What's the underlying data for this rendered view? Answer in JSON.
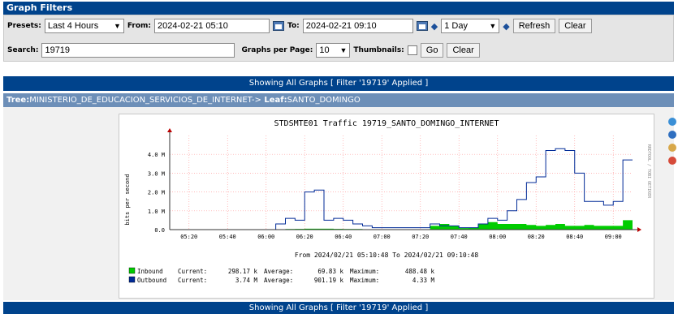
{
  "filters": {
    "title": "Graph Filters",
    "presets_label": "Presets:",
    "presets_value": "Last 4 Hours",
    "from_label": "From:",
    "from_value": "2024-02-21 05:10",
    "to_label": "To:",
    "to_value": "2024-02-21 09:10",
    "span_value": "1 Day",
    "refresh_label": "Refresh",
    "clear_label": "Clear",
    "search_label": "Search:",
    "search_value": "19719",
    "graphs_per_page_label": "Graphs per Page:",
    "graphs_per_page_value": "10",
    "thumbnails_label": "Thumbnails:",
    "go_label": "Go",
    "clear2_label": "Clear"
  },
  "showing_top": "Showing All Graphs [ Filter '19719' Applied ]",
  "tree": {
    "prefix": "Tree:",
    "tree_name": "MINISTERIO_DE_EDUCACION_SERVICIOS_DE_INTERNET->",
    "leaf_prefix": " Leaf:",
    "leaf_name": "SANTO_DOMINGO"
  },
  "showing_bottom": "Showing All Graphs [ Filter '19719' Applied ]",
  "side_icons": [
    "zoom-icon",
    "info-icon",
    "edit-icon",
    "delete-icon"
  ],
  "colors": {
    "header": "#00438c",
    "tree_bar": "#6d8fb8",
    "inbound": "#00cc00",
    "outbound": "#002a97",
    "grid": "#ff9f9f"
  },
  "chart_data": {
    "type": "area",
    "title": "STDSMTE01 Traffic 19719_SANTO_DOMINGO_INTERNET",
    "ylabel": "bits per second",
    "side_text": "RRDTOOL / TOBI OETIKER",
    "subtitle": "From 2024/02/21 05:10:48 To 2024/02/21 09:10:48",
    "x_ticks": [
      "05:20",
      "05:40",
      "06:00",
      "06:20",
      "06:40",
      "07:00",
      "07:20",
      "07:40",
      "08:00",
      "08:20",
      "08:40",
      "09:00"
    ],
    "y_ticks": [
      "0.0",
      "1.0 M",
      "2.0 M",
      "3.0 M",
      "4.0 M"
    ],
    "ylim": [
      0,
      5
    ],
    "x_minutes": [
      0,
      5,
      10,
      15,
      20,
      25,
      30,
      35,
      40,
      45,
      50,
      55,
      60,
      65,
      70,
      75,
      80,
      85,
      90,
      95,
      100,
      105,
      110,
      115,
      120,
      125,
      130,
      135,
      140,
      145,
      150,
      155,
      160,
      165,
      170,
      175,
      180,
      185,
      190,
      195,
      200,
      205,
      210,
      215,
      220,
      225,
      230,
      235,
      240
    ],
    "series": [
      {
        "name": "Inbound",
        "values": [
          0,
          0,
          0,
          0,
          0,
          0,
          0,
          0,
          0,
          0,
          0,
          0.02,
          0.03,
          0.04,
          0.05,
          0.05,
          0.05,
          0.04,
          0.03,
          0.03,
          0.02,
          0.02,
          0.02,
          0.02,
          0.02,
          0.02,
          0.02,
          0.2,
          0.3,
          0.2,
          0.08,
          0.1,
          0.3,
          0.4,
          0.3,
          0.3,
          0.3,
          0.25,
          0.2,
          0.25,
          0.3,
          0.2,
          0.2,
          0.25,
          0.2,
          0.2,
          0.2,
          0.5,
          0.3
        ]
      },
      {
        "name": "Outbound",
        "values": [
          0,
          0,
          0,
          0,
          0,
          0,
          0,
          0,
          0,
          0,
          0,
          0.3,
          0.6,
          0.5,
          2.0,
          2.1,
          0.5,
          0.6,
          0.5,
          0.3,
          0.2,
          0.1,
          0.1,
          0.1,
          0.1,
          0.1,
          0.1,
          0.3,
          0.2,
          0.2,
          0.1,
          0.1,
          0.3,
          0.6,
          0.5,
          1.0,
          1.6,
          2.5,
          2.8,
          4.2,
          4.3,
          4.2,
          3.0,
          1.5,
          1.5,
          1.3,
          1.5,
          3.7,
          3.7
        ]
      }
    ],
    "legend": [
      {
        "name": "Inbound",
        "current_label": "Current:",
        "current": "298.17 k",
        "average_label": "Average:",
        "average": "69.83 k",
        "maximum_label": "Maximum:",
        "maximum": "488.48 k"
      },
      {
        "name": "Outbound",
        "current_label": "Current:",
        "current": "3.74 M",
        "average_label": "Average:",
        "average": "901.19 k",
        "maximum_label": "Maximum:",
        "maximum": "4.33 M"
      }
    ]
  }
}
